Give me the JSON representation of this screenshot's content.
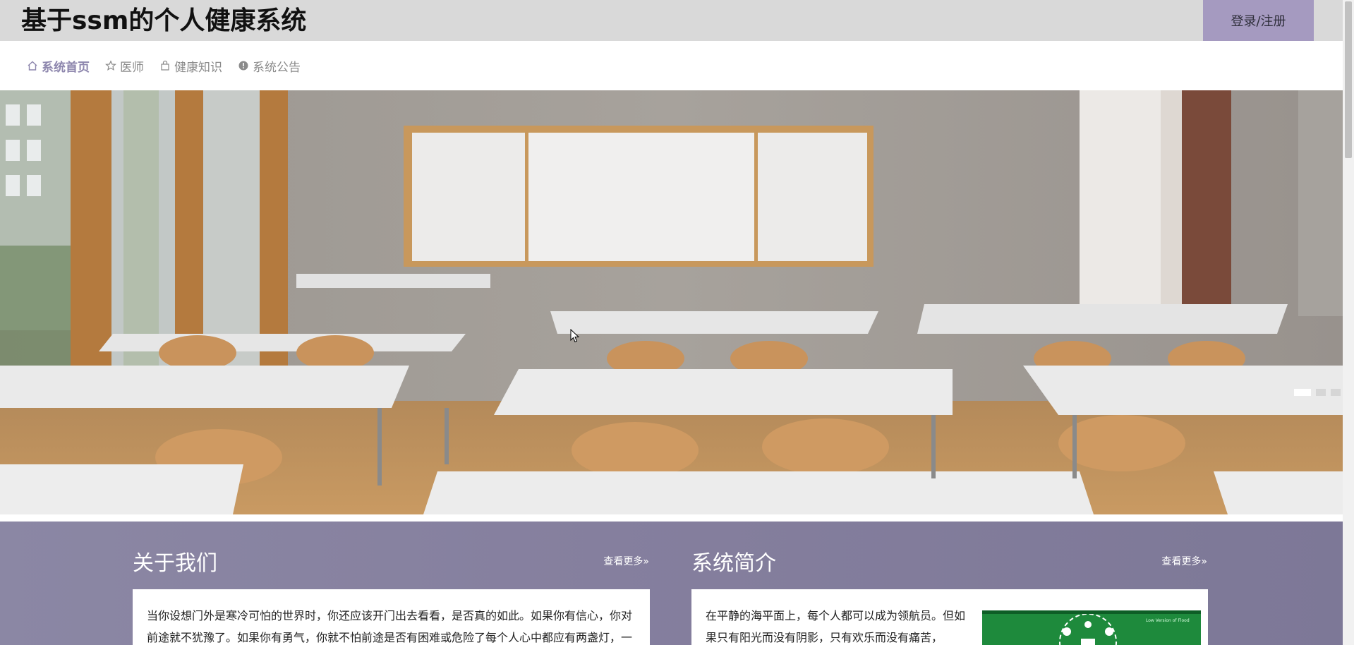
{
  "header": {
    "title": "基于ssm的个人健康系统",
    "login_label": "登录/注册"
  },
  "nav": {
    "items": [
      {
        "label": "系统首页",
        "icon": "home-icon",
        "active": true
      },
      {
        "label": "医师",
        "icon": "star-icon",
        "active": false
      },
      {
        "label": "健康知识",
        "icon": "bag-icon",
        "active": false
      },
      {
        "label": "系统公告",
        "icon": "info-icon",
        "active": false
      }
    ]
  },
  "banner": {
    "slide_count": 3,
    "active_slide": 1
  },
  "about": {
    "title": "关于我们",
    "more_label": "查看更多»",
    "text": "当你设想门外是寒冷可怕的世界时，你还应该开门出去看看，是否真的如此。如果你有信心，你对前途就不犹豫了。如果你有勇气，你就不怕前途是否有困难或危险了每个人心中都应有两盏灯，一"
  },
  "intro": {
    "title": "系统简介",
    "more_label": "查看更多»",
    "text": "在平静的海平面上，每个人都可以成为领航员。但如果只有阳光而没有阴影，只有欢乐而没有痛苦，",
    "image_caption": "Low Version of Flood"
  },
  "colors": {
    "header_bg": "#d9d9d9",
    "login_bg": "#a59ac0",
    "nav_active": "#8d86ad",
    "section_bg": "#857f9e"
  }
}
